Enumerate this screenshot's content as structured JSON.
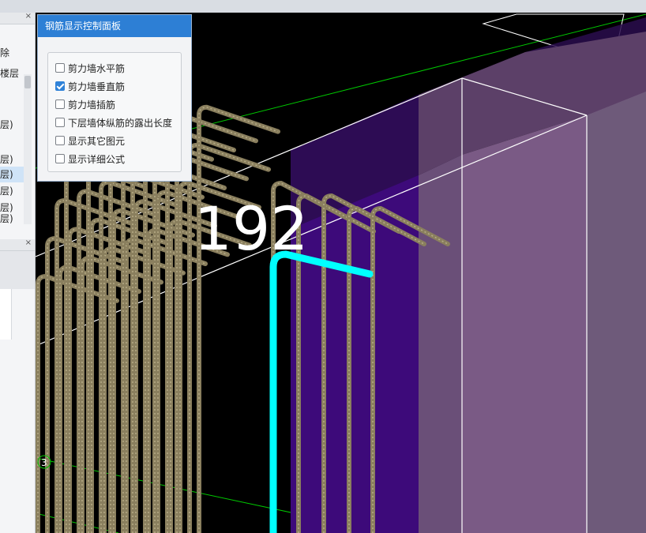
{
  "panel": {
    "title": "钢筋显示控制面板",
    "options": [
      {
        "label": "剪力墙水平筋",
        "checked": false
      },
      {
        "label": "剪力墙垂直筋",
        "checked": true
      },
      {
        "label": "剪力墙插筋",
        "checked": false
      },
      {
        "label": "下层墙体纵筋的露出长度",
        "checked": false
      },
      {
        "label": "显示其它图元",
        "checked": false
      },
      {
        "label": "显示详细公式",
        "checked": false
      }
    ]
  },
  "left": {
    "close_glyph": "×",
    "close_glyph_2": "×",
    "delete_label": "除",
    "floor_label": "楼层",
    "rows": [
      "层)",
      "层)",
      "层)",
      "层)",
      "层)",
      "层)"
    ],
    "row_partial": "层)",
    "marker": "3"
  },
  "viewport": {
    "dimension_label": "192"
  },
  "colors": {
    "highlight_bar": "#00ffff",
    "wall_front": "#3d0a7a",
    "wall_side": "#7a5a85",
    "wall_top": "#6a4f78",
    "rebar": "#8a7f5e",
    "panel_title_bg": "#2d7fd5",
    "guide_line": "#00c800"
  }
}
